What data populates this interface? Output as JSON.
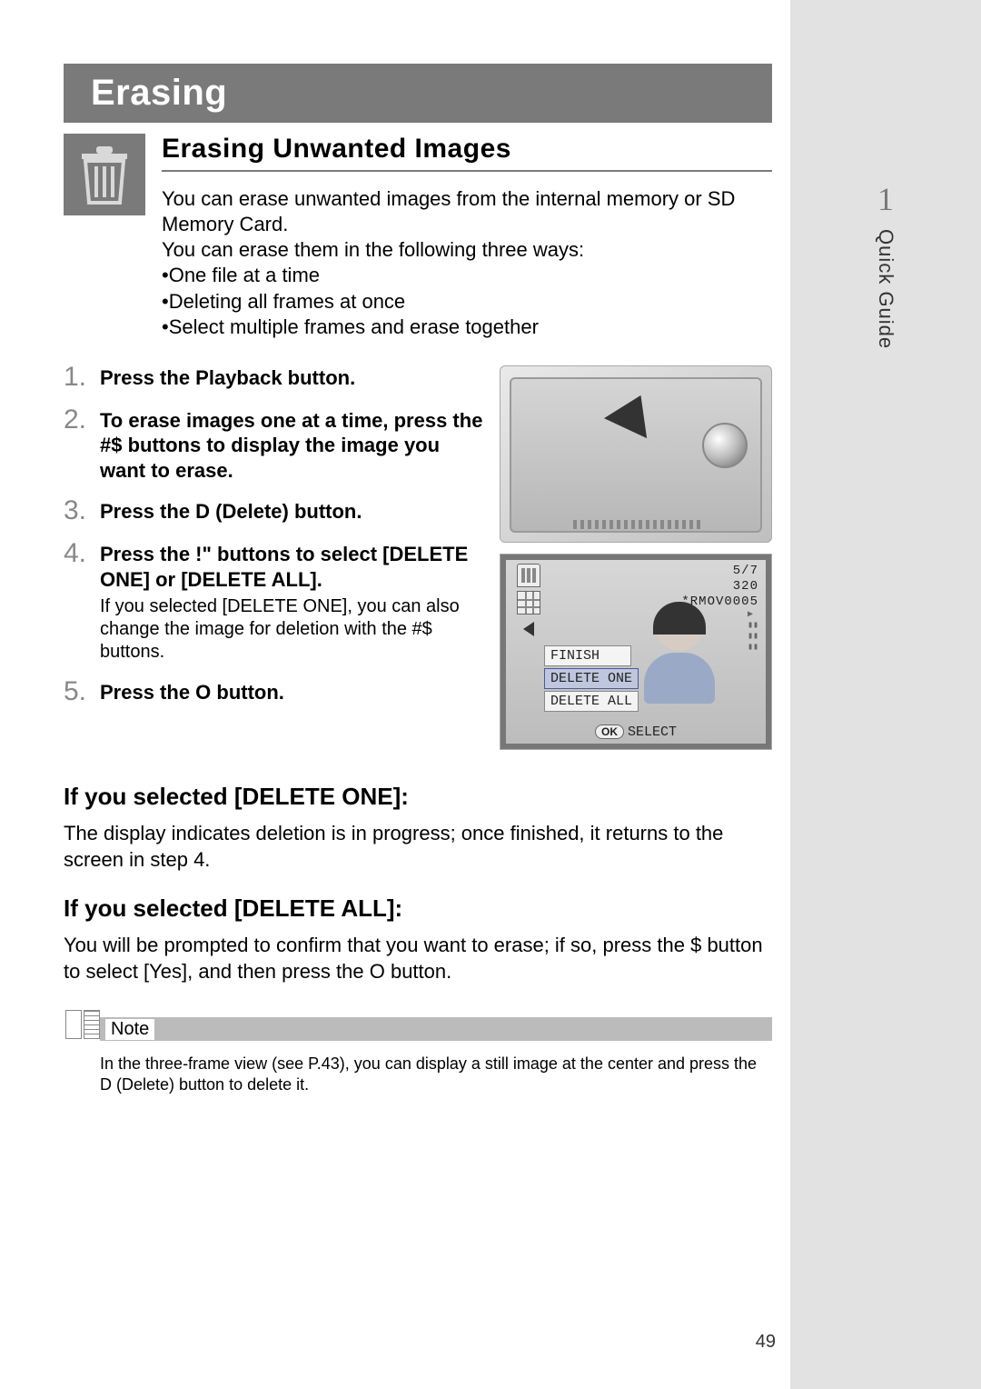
{
  "header": {
    "title": "Erasing"
  },
  "section": {
    "title": "Erasing Unwanted Images",
    "intro_l1": "You can erase unwanted images from the internal memory or SD Memory Card.",
    "intro_l2": "You can erase them in the following three ways:",
    "intro_b1": "•One file at a time",
    "intro_b2": "•Deleting all frames at once",
    "intro_b3": "•Select multiple frames and erase together"
  },
  "steps": {
    "s1_num": "1.",
    "s1": "Press the Playback button.",
    "s2_num": "2.",
    "s2": "To erase images one at a time, press the #$ buttons to display the image you want to erase.",
    "s3_num": "3.",
    "s3": "Press the D (Delete) button.",
    "s4_num": "4.",
    "s4": "Press the !\" buttons to select [DELETE ONE] or [DELETE ALL].",
    "s4_sub": "If you selected [DELETE ONE], you can also change the image for deletion with the #$ buttons.",
    "s5_num": "5.",
    "s5": "Press the O button."
  },
  "screen": {
    "counter": "5/7",
    "res": "320",
    "file": "*RMOV0005",
    "m1": "FINISH",
    "m2": "DELETE ONE",
    "m3": "DELETE ALL",
    "ok": "OK",
    "select": "SELECT"
  },
  "sub1": {
    "h": "If you selected [DELETE ONE]:",
    "p": "The display indicates deletion is in progress; once finished, it returns to the screen in step 4."
  },
  "sub2": {
    "h": "If you selected [DELETE ALL]:",
    "p": "You will be prompted to confirm that you want to erase; if so, press the $ button to select [Yes], and then press the O button."
  },
  "note": {
    "label": "Note",
    "body": "In the three-frame view (see P.43), you can display a still image at the center and press the D (Delete) button to delete it."
  },
  "sidebar": {
    "chapter": "1",
    "label": "Quick Guide"
  },
  "page_number": "49"
}
